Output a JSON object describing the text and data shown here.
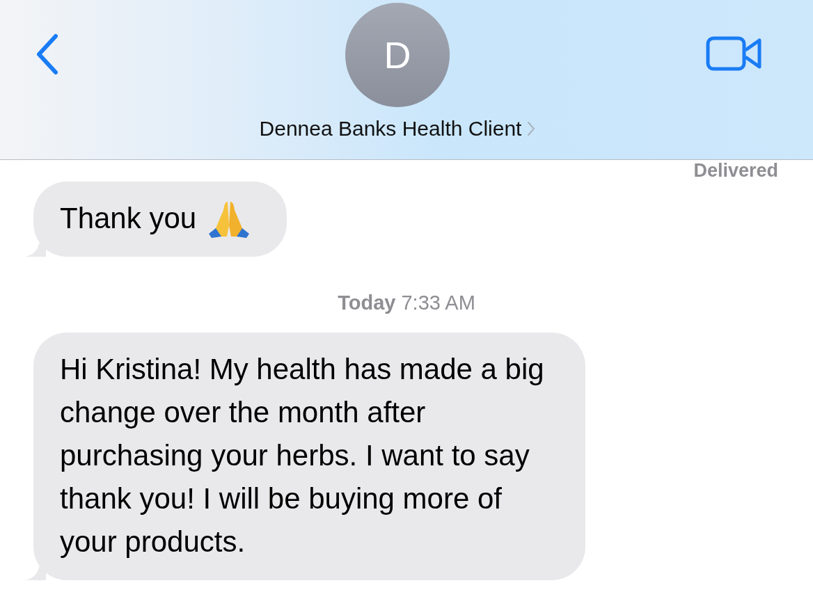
{
  "header": {
    "avatar_initial": "D",
    "contact_name": "Dennea Banks Health Client"
  },
  "status": "Delivered",
  "messages": [
    {
      "kind": "bubble",
      "text": "Thank you",
      "emoji": true
    },
    {
      "kind": "timestamp",
      "day": "Today",
      "time": "7:33 AM"
    },
    {
      "kind": "bubble",
      "text": "Hi Kristina! My health has made a big change over the month after purchasing your herbs. I want to say thank you! I will be buying more of your products.",
      "emoji": false
    }
  ]
}
